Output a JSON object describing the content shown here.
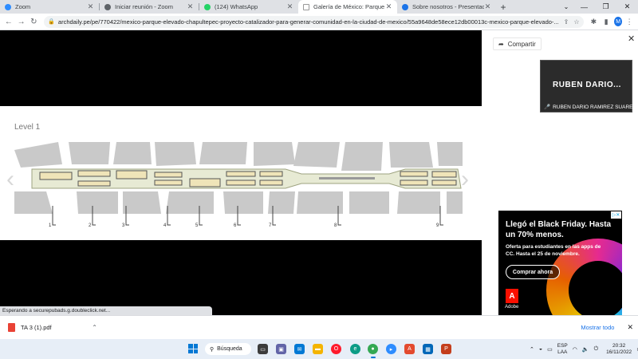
{
  "tabs": [
    {
      "title": "Zoom",
      "icon_color": "#2d8cff",
      "active": false
    },
    {
      "title": "Iniciar reunión - Zoom",
      "icon_color": "#5f6368",
      "active": false
    },
    {
      "title": "(124) WhatsApp",
      "icon_color": "#25d366",
      "active": false
    },
    {
      "title": "Galería de México: Parque Elevad",
      "icon_color": "#ffffff",
      "active": true
    },
    {
      "title": "Sobre nosotros - Presentación",
      "icon_color": "#1a73e8",
      "active": false
    }
  ],
  "toolbar": {
    "url": "archdaily.pe/pe/770422/mexico-parque-elevado-chapultepec-proyecto-catalizador-para-generar-comunidad-en-la-ciudad-de-mexico/55a9648de58ece12db00013c-mexico-parque-elevado-...",
    "profile_initial": "M"
  },
  "gallery": {
    "level_label": "Level 1",
    "section_numbers": [
      "1",
      "2",
      "3",
      "4",
      "5",
      "6",
      "7",
      "8",
      "9"
    ]
  },
  "side_panel": {
    "share_label": "Compartir",
    "video_name": "RUBEN  DARIO...",
    "video_caption": "RUBEN DARIO RAMIREZ SUAREZ"
  },
  "ad": {
    "title": "Llegó el Black Friday. Hasta un 70% menos.",
    "subtitle": "Oferta para estudiantes en las apps de CC. Hasta el 25 de noviembre.",
    "button": "Comprar ahora",
    "brand": "Adobe"
  },
  "status_text": "Esperando a securepubads.g.doubleclick.net...",
  "download": {
    "file_name": "TA 3 (1).pdf",
    "show_all": "Mostrar todo"
  },
  "taskbar": {
    "search_label": "Búsqueda",
    "lang_1": "ESP",
    "lang_2": "LAA",
    "time": "20:32",
    "date": "16/11/2022"
  }
}
